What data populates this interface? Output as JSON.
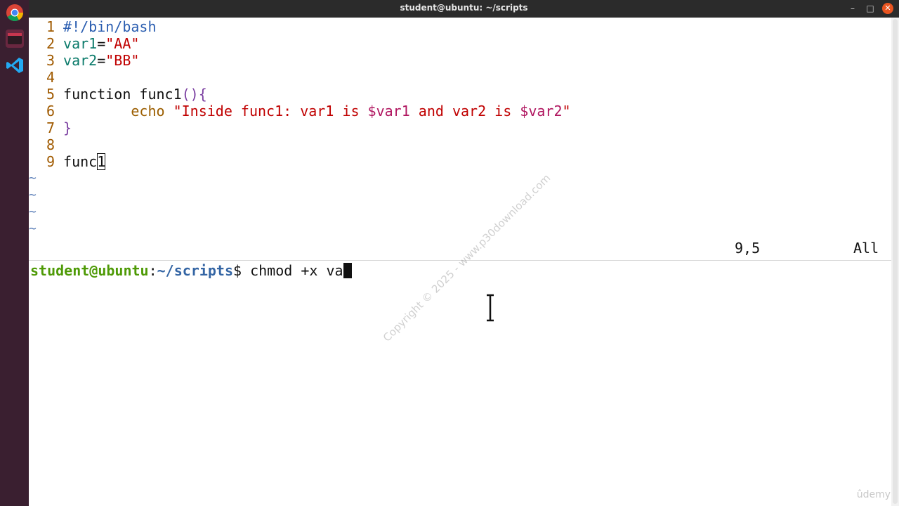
{
  "window": {
    "title": "student@ubuntu: ~/scripts"
  },
  "dock": {
    "icons": [
      "chrome-icon",
      "terminal-icon",
      "vscode-icon"
    ]
  },
  "editor": {
    "lines": [
      {
        "num": "1",
        "parts": [
          {
            "t": "#!/bin/bash",
            "c": "cmt"
          }
        ]
      },
      {
        "num": "2",
        "parts": [
          {
            "t": "var1",
            "c": "var"
          },
          {
            "t": "=",
            "c": "code"
          },
          {
            "t": "\"AA\"",
            "c": "str"
          }
        ]
      },
      {
        "num": "3",
        "parts": [
          {
            "t": "var2",
            "c": "var"
          },
          {
            "t": "=",
            "c": "code"
          },
          {
            "t": "\"BB\"",
            "c": "str"
          }
        ]
      },
      {
        "num": "4",
        "parts": []
      },
      {
        "num": "5",
        "parts": [
          {
            "t": "function func1",
            "c": "fn"
          },
          {
            "t": "()",
            "c": "paren"
          },
          {
            "t": "{",
            "c": "paren"
          }
        ]
      },
      {
        "num": "6",
        "parts": [
          {
            "t": "        ",
            "c": "code"
          },
          {
            "t": "echo",
            "c": "kw"
          },
          {
            "t": " \"Inside func1: var1 is ",
            "c": "str"
          },
          {
            "t": "$var1",
            "c": "dollar"
          },
          {
            "t": " and var2 is ",
            "c": "str"
          },
          {
            "t": "$var2",
            "c": "dollar"
          },
          {
            "t": "\"",
            "c": "str"
          }
        ]
      },
      {
        "num": "7",
        "parts": [
          {
            "t": "}",
            "c": "paren"
          }
        ]
      },
      {
        "num": "8",
        "parts": []
      },
      {
        "num": "9",
        "parts": [
          {
            "t": "func",
            "c": "code"
          },
          {
            "t": "1",
            "c": "cursor"
          }
        ]
      }
    ],
    "tilde_lines": [
      "~",
      "~",
      "~",
      "~"
    ],
    "status_position": "9,5",
    "status_scroll": "All"
  },
  "terminal": {
    "user_host": "student@ubuntu",
    "separator": ":",
    "cwd": "~/scripts",
    "prompt_char": "$",
    "command": " chmod +x va"
  },
  "watermark": "Copyright © 2025 - www.p30download.com",
  "brand": "ûdemy"
}
